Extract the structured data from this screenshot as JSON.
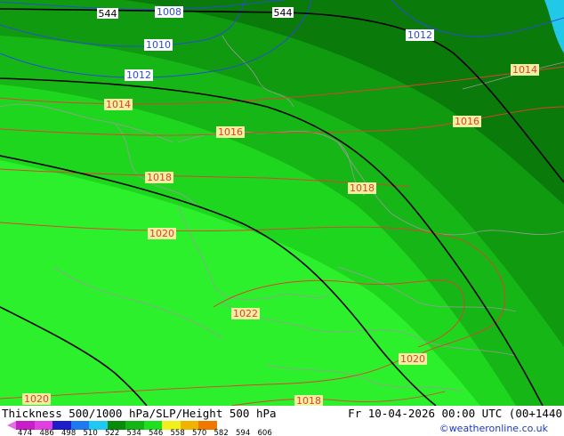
{
  "map": {
    "isobar_labels": [
      "1008",
      "1010",
      "1012",
      "1012",
      "1014",
      "1014",
      "1016",
      "1016",
      "1018",
      "1018",
      "1020",
      "1022",
      "1020",
      "1020",
      "1018"
    ],
    "height_labels": [
      "544",
      "544"
    ],
    "colors": {
      "field_dark": "#0a7a0a",
      "field_mid": "#0f9a0f",
      "field_light": "#16b616",
      "field_bright": "#1fd61f",
      "field_lime": "#2cf02c",
      "sea_cyan": "#22c8e8",
      "isobar_blue": "#2a4cd8",
      "isobar_red": "#e04030",
      "height_black": "#000000",
      "border": "#9a9a9a"
    }
  },
  "footer": {
    "title": "Thickness 500/1000 hPa/SLP/Height 500 hPa",
    "valid_time": "Fr 10-04-2026 00:00 UTC (00+1440",
    "credit": "©weatheronline.co.uk",
    "scale_values": [
      "474",
      "486",
      "498",
      "510",
      "522",
      "534",
      "546",
      "558",
      "570",
      "582",
      "594",
      "606"
    ],
    "scale_colors": [
      "#c81ec8",
      "#e040e0",
      "#1e1ec8",
      "#1e78f0",
      "#1ec8f0",
      "#0a8a0a",
      "#14b414",
      "#1ee01e",
      "#f0f01e",
      "#f0b400",
      "#f07800"
    ]
  }
}
